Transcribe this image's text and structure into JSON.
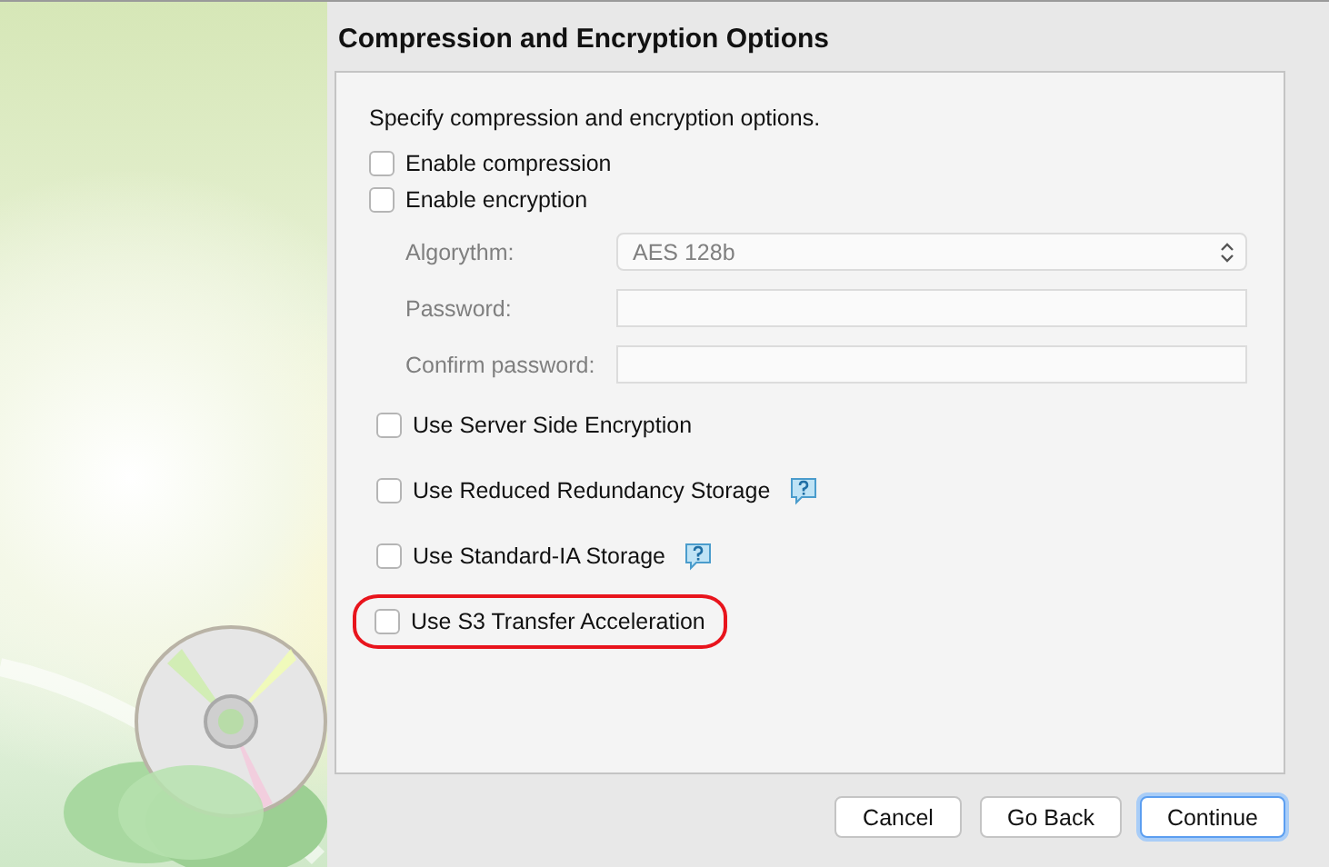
{
  "title": "Compression and Encryption Options",
  "intro": "Specify compression and encryption options.",
  "main_options": [
    {
      "label": "Enable compression",
      "checked": false
    },
    {
      "label": "Enable encryption",
      "checked": false
    }
  ],
  "encryption": {
    "disabled": true,
    "algorithm": {
      "label": "Algorythm:",
      "value": "AES 128b"
    },
    "password": {
      "label": "Password:"
    },
    "confirm_password": {
      "label": "Confirm password:"
    }
  },
  "storage_options": [
    {
      "label": "Use Server Side Encryption",
      "checked": false,
      "help": false,
      "highlighted": false
    },
    {
      "label": "Use Reduced Redundancy Storage",
      "checked": false,
      "help": true,
      "highlighted": false
    },
    {
      "label": "Use Standard-IA Storage",
      "checked": false,
      "help": true,
      "highlighted": false
    },
    {
      "label": "Use S3 Transfer Acceleration",
      "checked": false,
      "help": false,
      "highlighted": true
    }
  ],
  "buttons": [
    {
      "label": "Cancel",
      "default": false
    },
    {
      "label": "Go Back",
      "default": false
    },
    {
      "label": "Continue",
      "default": true
    }
  ]
}
